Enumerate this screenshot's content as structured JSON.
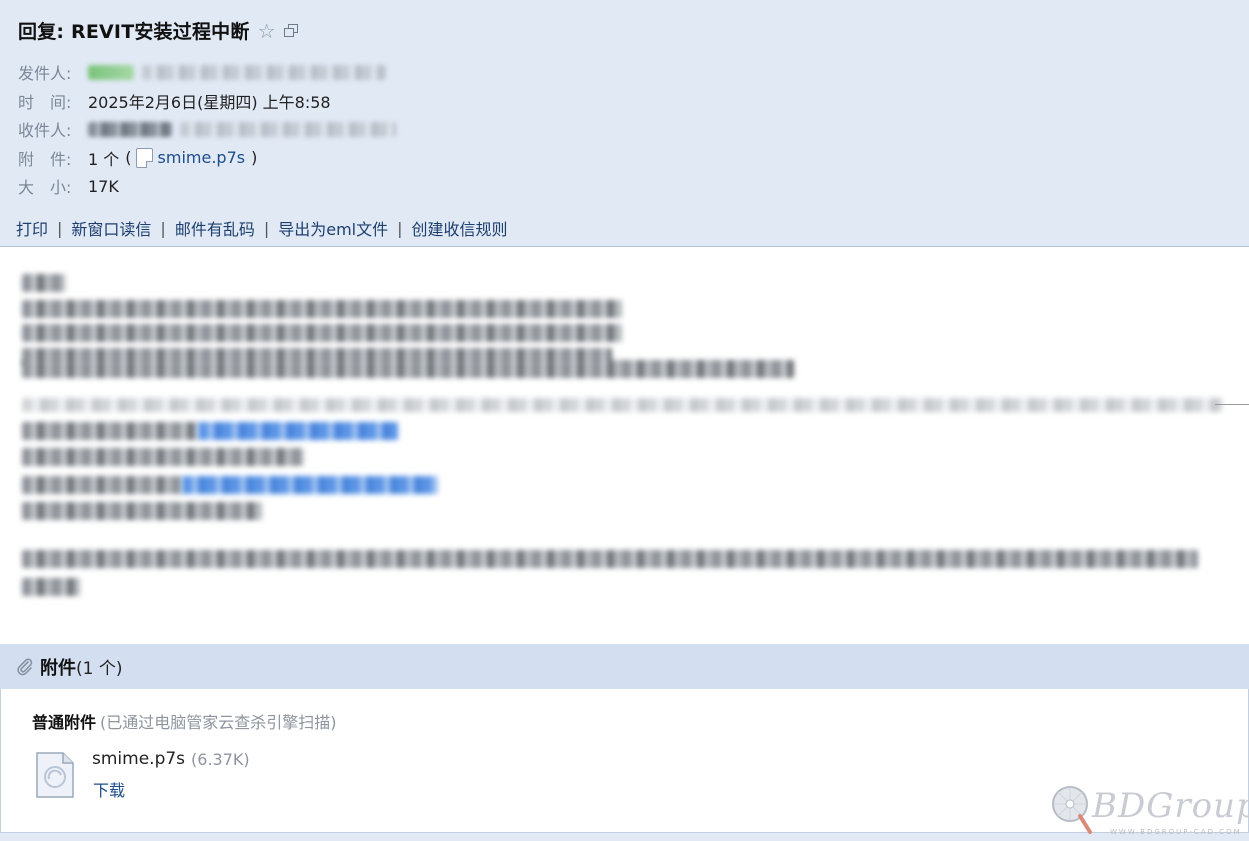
{
  "subject": "回复: REVIT安装过程中断",
  "meta": {
    "from_label": "发件人:",
    "time_label": "时　间:",
    "time_value": "2025年2月6日(星期四) 上午8:58",
    "to_label": "收件人:",
    "attach_label": "附　件:",
    "attach_count": "1 个",
    "attach_open": "(",
    "attach_file": "smime.p7s",
    "attach_close": ")",
    "size_label": "大　小:",
    "size_value": "17K"
  },
  "actions": [
    "打印",
    "新窗口读信",
    "邮件有乱码",
    "导出为eml文件",
    "创建收信规则"
  ],
  "action_separator": "|",
  "attachments": {
    "title": "附件",
    "count": "(1 个)",
    "kind": "普通附件",
    "scan_note": "(已通过电脑管家云查杀引擎扫描)",
    "file_name": "smime.p7s",
    "file_size": "(6.37K)",
    "download": "下载"
  },
  "watermark": {
    "text": "BDGroup",
    "sub": "WWW.BDGROUP-CAD.COM"
  },
  "icons": {
    "star": "star-icon",
    "popout": "popout-window-icon",
    "file": "file-icon",
    "paperclip": "paperclip-icon"
  }
}
